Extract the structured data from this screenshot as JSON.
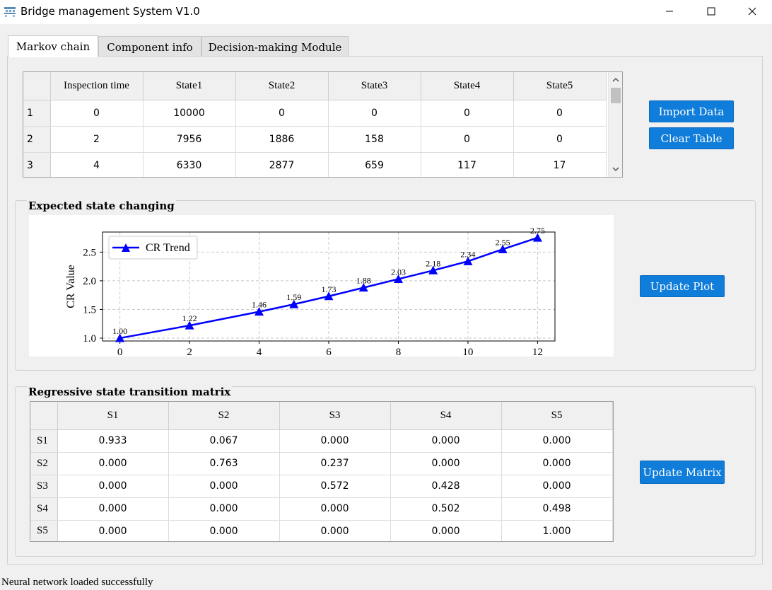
{
  "window": {
    "title": "Bridge management System V1.0"
  },
  "tabs": [
    {
      "label": "Markov chain",
      "active": true
    },
    {
      "label": "Component info",
      "active": false
    },
    {
      "label": "Decision-making Module",
      "active": false
    }
  ],
  "inspection_table": {
    "columns": [
      "Inspection time",
      "State1",
      "State2",
      "State3",
      "State4",
      "State5"
    ],
    "rows": [
      {
        "index": "1",
        "cells": [
          "0",
          "10000",
          "0",
          "0",
          "0",
          "0"
        ]
      },
      {
        "index": "2",
        "cells": [
          "2",
          "7956",
          "1886",
          "158",
          "0",
          "0"
        ]
      },
      {
        "index": "3",
        "cells": [
          "4",
          "6330",
          "2877",
          "659",
          "117",
          "17"
        ]
      }
    ]
  },
  "buttons": {
    "import_data": "Import Data",
    "clear_table": "Clear Table",
    "update_plot": "Update Plot",
    "update_matrix": "Update Matrix"
  },
  "plot_group": {
    "title": "Expected state changing"
  },
  "chart_data": {
    "type": "line",
    "title": "",
    "xlabel": "",
    "ylabel": "CR Value",
    "xlim": [
      -0.5,
      12.5
    ],
    "ylim": [
      0.95,
      2.85
    ],
    "xticks": [
      0,
      2,
      4,
      6,
      8,
      10,
      12
    ],
    "yticks": [
      1.0,
      1.5,
      2.0,
      2.5
    ],
    "grid": true,
    "legend_position": "top-left",
    "series": [
      {
        "name": "CR Trend",
        "color": "#0000ff",
        "marker": "triangle",
        "x": [
          0,
          2,
          4,
          5,
          6,
          7,
          8,
          9,
          10,
          11,
          12
        ],
        "y": [
          1.0,
          1.22,
          1.46,
          1.59,
          1.73,
          1.88,
          2.03,
          2.18,
          2.34,
          2.55,
          2.75
        ],
        "labels": [
          "1.00",
          "1.22",
          "1.46",
          "1.59",
          "1.73",
          "1.88",
          "2.03",
          "2.18",
          "2.34",
          "2.55",
          "2.75"
        ]
      }
    ]
  },
  "matrix_group": {
    "title": "Regressive state transition matrix"
  },
  "matrix_table": {
    "columns": [
      "S1",
      "S2",
      "S3",
      "S4",
      "S5"
    ],
    "rows": [
      {
        "label": "S1",
        "cells": [
          "0.933",
          "0.067",
          "0.000",
          "0.000",
          "0.000"
        ]
      },
      {
        "label": "S2",
        "cells": [
          "0.000",
          "0.763",
          "0.237",
          "0.000",
          "0.000"
        ]
      },
      {
        "label": "S3",
        "cells": [
          "0.000",
          "0.000",
          "0.572",
          "0.428",
          "0.000"
        ]
      },
      {
        "label": "S4",
        "cells": [
          "0.000",
          "0.000",
          "0.000",
          "0.502",
          "0.498"
        ]
      },
      {
        "label": "S5",
        "cells": [
          "0.000",
          "0.000",
          "0.000",
          "0.000",
          "1.000"
        ]
      }
    ]
  },
  "status_bar": {
    "text": "Neural network loaded successfully"
  },
  "colors": {
    "accent": "#0f7dd9",
    "series": "#0000ff"
  }
}
